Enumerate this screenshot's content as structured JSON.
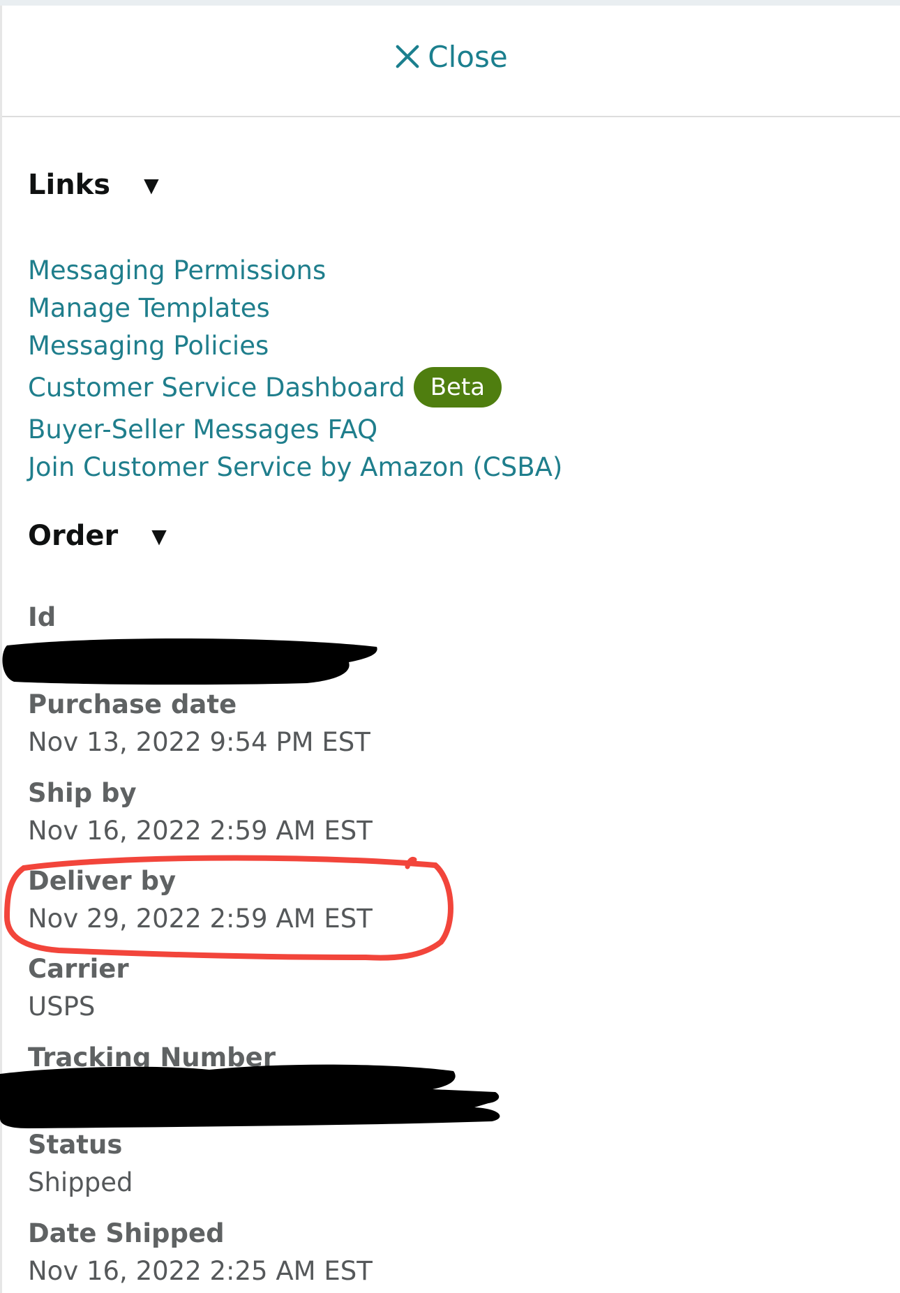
{
  "header": {
    "close_label": "Close"
  },
  "links_section": {
    "title": "Links",
    "items": [
      "Messaging Permissions",
      "Manage Templates",
      "Messaging Policies",
      "Customer Service Dashboard",
      "Buyer-Seller Messages FAQ",
      "Join Customer Service by Amazon (CSBA)"
    ],
    "badge": "Beta"
  },
  "order_section": {
    "title": "Order",
    "fields": {
      "id": {
        "label": "Id"
      },
      "purchase_date": {
        "label": "Purchase date",
        "value": "Nov 13, 2022 9:54 PM EST"
      },
      "ship_by": {
        "label": "Ship by",
        "value": "Nov 16, 2022 2:59 AM EST"
      },
      "deliver_by": {
        "label": "Deliver by",
        "value": "Nov 29, 2022 2:59 AM EST"
      },
      "carrier": {
        "label": "Carrier",
        "value": "USPS"
      },
      "tracking_number": {
        "label": "Tracking Number"
      },
      "status": {
        "label": "Status",
        "value": "Shipped"
      },
      "date_shipped": {
        "label": "Date Shipped",
        "value": "Nov 16, 2022 2:25 AM EST"
      }
    }
  },
  "colors": {
    "link": "#1f7e8c",
    "badge": "#4f7e0f",
    "highlight_circle": "#f2453b"
  }
}
